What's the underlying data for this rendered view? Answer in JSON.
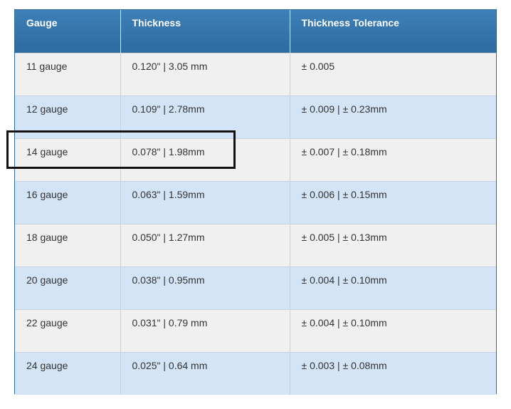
{
  "table": {
    "headers": [
      "Gauge",
      "Thickness",
      "Thickness Tolerance"
    ],
    "rows": [
      {
        "gauge": "11 gauge",
        "thickness": "0.120\" | 3.05 mm",
        "tolerance": "± 0.005"
      },
      {
        "gauge": "12 gauge",
        "thickness": "0.109\" | 2.78mm",
        "tolerance": "± 0.009 | ± 0.23mm"
      },
      {
        "gauge": "14 gauge",
        "thickness": "0.078\" | 1.98mm",
        "tolerance": "± 0.007 | ± 0.18mm"
      },
      {
        "gauge": "16 gauge",
        "thickness": "0.063\" | 1.59mm",
        "tolerance": "± 0.006 | ± 0.15mm"
      },
      {
        "gauge": "18 gauge",
        "thickness": "0.050\" | 1.27mm",
        "tolerance": "± 0.005 | ± 0.13mm"
      },
      {
        "gauge": "20 gauge",
        "thickness": "0.038\" | 0.95mm",
        "tolerance": "± 0.004 | ± 0.10mm"
      },
      {
        "gauge": "22 gauge",
        "thickness": "0.031\" | 0.79 mm",
        "tolerance": "± 0.004 | ± 0.10mm"
      },
      {
        "gauge": "24 gauge",
        "thickness": "0.025\" | 0.64 mm",
        "tolerance": "± 0.003 | ± 0.08mm"
      }
    ]
  },
  "highlight": {
    "row": "14 gauge"
  },
  "colors": {
    "header_bg": "#2c6aa0",
    "row_light": "#f0f0f0",
    "row_blue": "#d2e4f5",
    "highlight_border": "#111111"
  }
}
